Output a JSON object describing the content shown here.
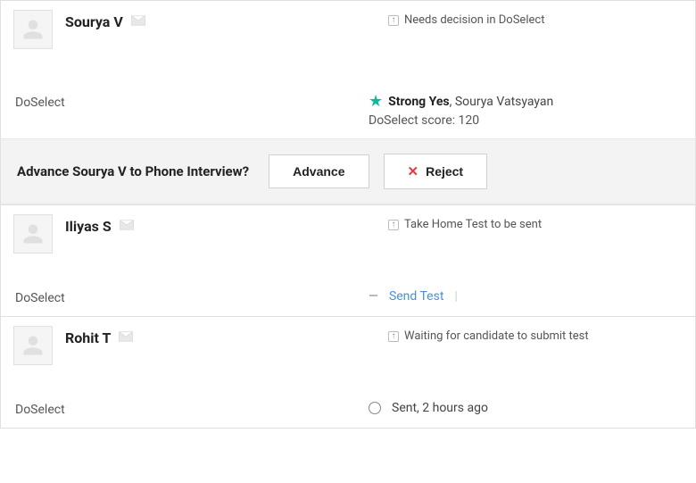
{
  "candidates": [
    {
      "name": "Sourya V",
      "status": "Needs decision in DoSelect",
      "stage": "DoSelect",
      "recommendation": {
        "verdict": "Strong Yes",
        "by": "Sourya Vatsyayan"
      },
      "score_line": "DoSelect score: 120",
      "action": {
        "prompt": "Advance Sourya V to Phone Interview?",
        "advance_label": "Advance",
        "reject_label": "Reject"
      }
    },
    {
      "name": "Iliyas S",
      "status": "Take Home Test to be sent",
      "stage": "DoSelect",
      "cta": {
        "label": "Send Test"
      }
    },
    {
      "name": "Rohit T",
      "status": "Waiting for candidate to submit test",
      "stage": "DoSelect",
      "sent_line": "Sent, 2 hours ago"
    }
  ]
}
